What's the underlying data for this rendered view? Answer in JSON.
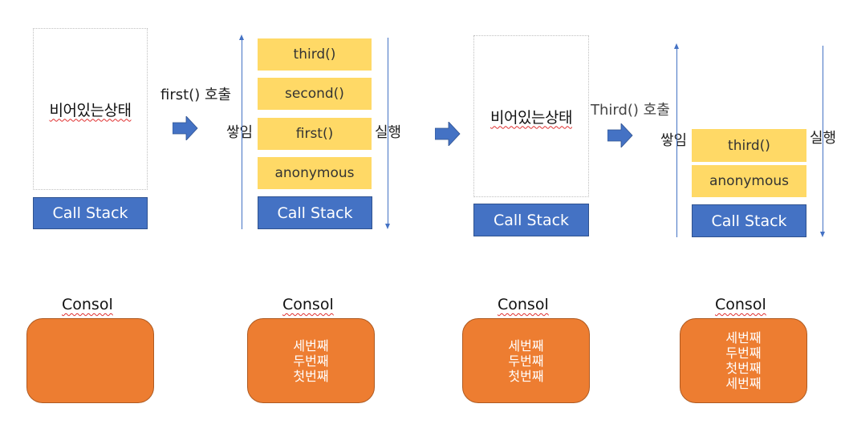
{
  "colors": {
    "call_stack_fill": "#4472c4",
    "frame_fill": "#ffd966",
    "console_fill": "#ed7d31",
    "arrow": "#4472c4"
  },
  "call_stack_label": "Call Stack",
  "empty_state_label": "비어있는상태",
  "stack_label": "쌓임",
  "execute_label": "실행",
  "console_title": "Consol",
  "arrow_icon": "right-arrow",
  "steps": [
    {
      "call_stack_frames": [],
      "console_lines": []
    },
    {
      "transition_label": "first() 호출",
      "call_stack_frames": [
        "third()",
        "second()",
        "first()",
        "anonymous"
      ],
      "console_lines": [
        "세번째",
        "두번째",
        "첫번째"
      ]
    },
    {
      "call_stack_frames": [],
      "console_lines": [
        "세번째",
        "두번째",
        "첫번째"
      ]
    },
    {
      "transition_label": "Third() 호출",
      "call_stack_frames": [
        "third()",
        "anonymous"
      ],
      "console_lines": [
        "세번째",
        "두번째",
        "첫번째",
        "세번째"
      ]
    }
  ]
}
